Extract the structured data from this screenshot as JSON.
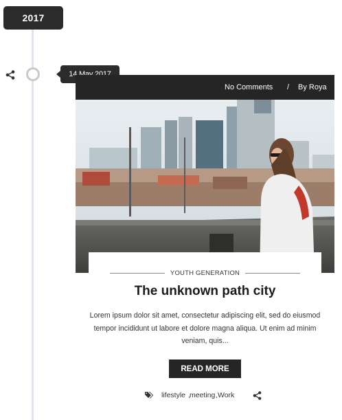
{
  "timeline": {
    "year": "2017"
  },
  "post": {
    "date": "14 May 2017",
    "comments": "No Comments",
    "separator": "/",
    "author": "By Roya",
    "category": "YOUTH GENERATION",
    "title": "The unknown path city",
    "excerpt": "Lorem ipsum dolor sit amet, consectetur adipiscing elit, sed do eiusmod tempor incididunt ut labore et dolore magna aliqua. Ut enim ad minim veniam, quis...",
    "read_more": "READ MORE",
    "tags": [
      "lifestyle",
      "meeting",
      "Work"
    ],
    "tag_separator": ","
  },
  "icons": {
    "side_share": "share-icon",
    "tags": "tag-icon",
    "bottom_share": "share-icon"
  },
  "colors": {
    "dark": "#252525",
    "timeline_line": "#e3e3ef",
    "node_ring": "#c9c9c9"
  }
}
